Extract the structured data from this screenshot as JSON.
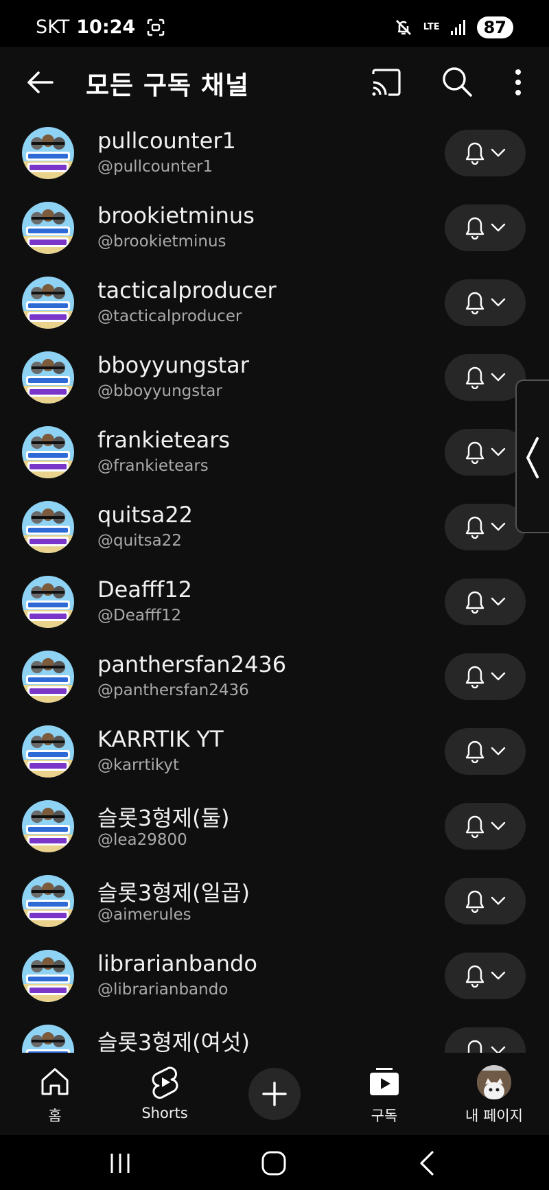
{
  "status_bar": {
    "carrier": "SKT",
    "time": "10:24",
    "network": "LTE",
    "battery": "87"
  },
  "header": {
    "title": "모든 구독 채널"
  },
  "channels": [
    {
      "name": "pullcounter1",
      "handle": "@pullcounter1",
      "avatar_caption": "행복슬롯 슬롯3형제"
    },
    {
      "name": "brookietminus",
      "handle": "@brookietminus",
      "avatar_caption": "행복슬롯 슬롯카메오"
    },
    {
      "name": "tacticalproducer",
      "handle": "@tacticalproducer",
      "avatar_caption": "행복슬롯 슬롯3형제"
    },
    {
      "name": "bboyyungstar",
      "handle": "@bboyyungstar",
      "avatar_caption": "행복슬롯 슬롯3형제"
    },
    {
      "name": "frankietears",
      "handle": "@frankietears",
      "avatar_caption": "행복슬롯 슬롯카메오"
    },
    {
      "name": "quitsa22",
      "handle": "@quitsa22",
      "avatar_caption": "행복슬롯 슬롯3형제"
    },
    {
      "name": "Deafff12",
      "handle": "@Deafff12",
      "avatar_caption": "행복슬롯 슬롯3형제"
    },
    {
      "name": "panthersfan2436",
      "handle": "@panthersfan2436",
      "avatar_caption": "행복슬롯 슬롯카메오"
    },
    {
      "name": "KARRTIK YT",
      "handle": "@karrtikyt",
      "avatar_caption": "행복슬롯 슬롯3형제"
    },
    {
      "name": "슬롯3형제(둘)",
      "handle": "@lea29800",
      "avatar_caption": "행복슬롯 슬롯3형제"
    },
    {
      "name": "슬롯3형제(일곱)",
      "handle": "@aimerules",
      "avatar_caption": "행복슬롯 슬롯카메오"
    },
    {
      "name": "librarianbando",
      "handle": "@librarianbando",
      "avatar_caption": "행복슬롯 슬롯카메오"
    },
    {
      "name": "슬롯3형제(여섯)",
      "handle": "",
      "avatar_caption": "행복슬롯 슬롯3형제"
    }
  ],
  "bottom_nav": {
    "home": "홈",
    "shorts": "Shorts",
    "subscriptions": "구독",
    "profile": "내 페이지"
  }
}
